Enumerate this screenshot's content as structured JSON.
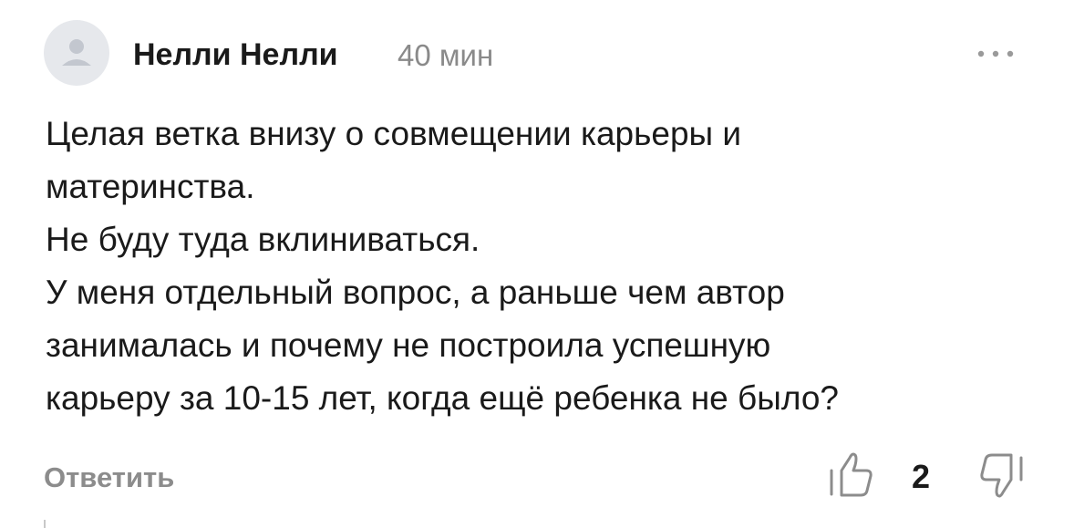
{
  "comment": {
    "avatar_icon": "user-silhouette-icon",
    "author": "Нелли Нелли",
    "time": "40 мин",
    "more_icon": "more-dots-icon",
    "paragraphs": [
      "Целая ветка внизу о совмещении карьеры и\nматеринства.",
      "Не буду туда вклиниваться.",
      "У меня отдельный вопрос, а раньше чем автор\nзанималась и почему не построила успешную\nкарьеру за 10-15 лет, когда ещё ребенка не было?"
    ],
    "reply_label": "Ответить",
    "like_icon": "thumbs-up-icon",
    "like_count": "2",
    "dislike_icon": "thumbs-down-icon"
  },
  "colors": {
    "text": "#1a1a1a",
    "muted": "#8a8a8a",
    "avatar_bg": "#e6e8ec",
    "avatar_fg": "#c3c7cf",
    "icon": "#8c8c8c"
  }
}
